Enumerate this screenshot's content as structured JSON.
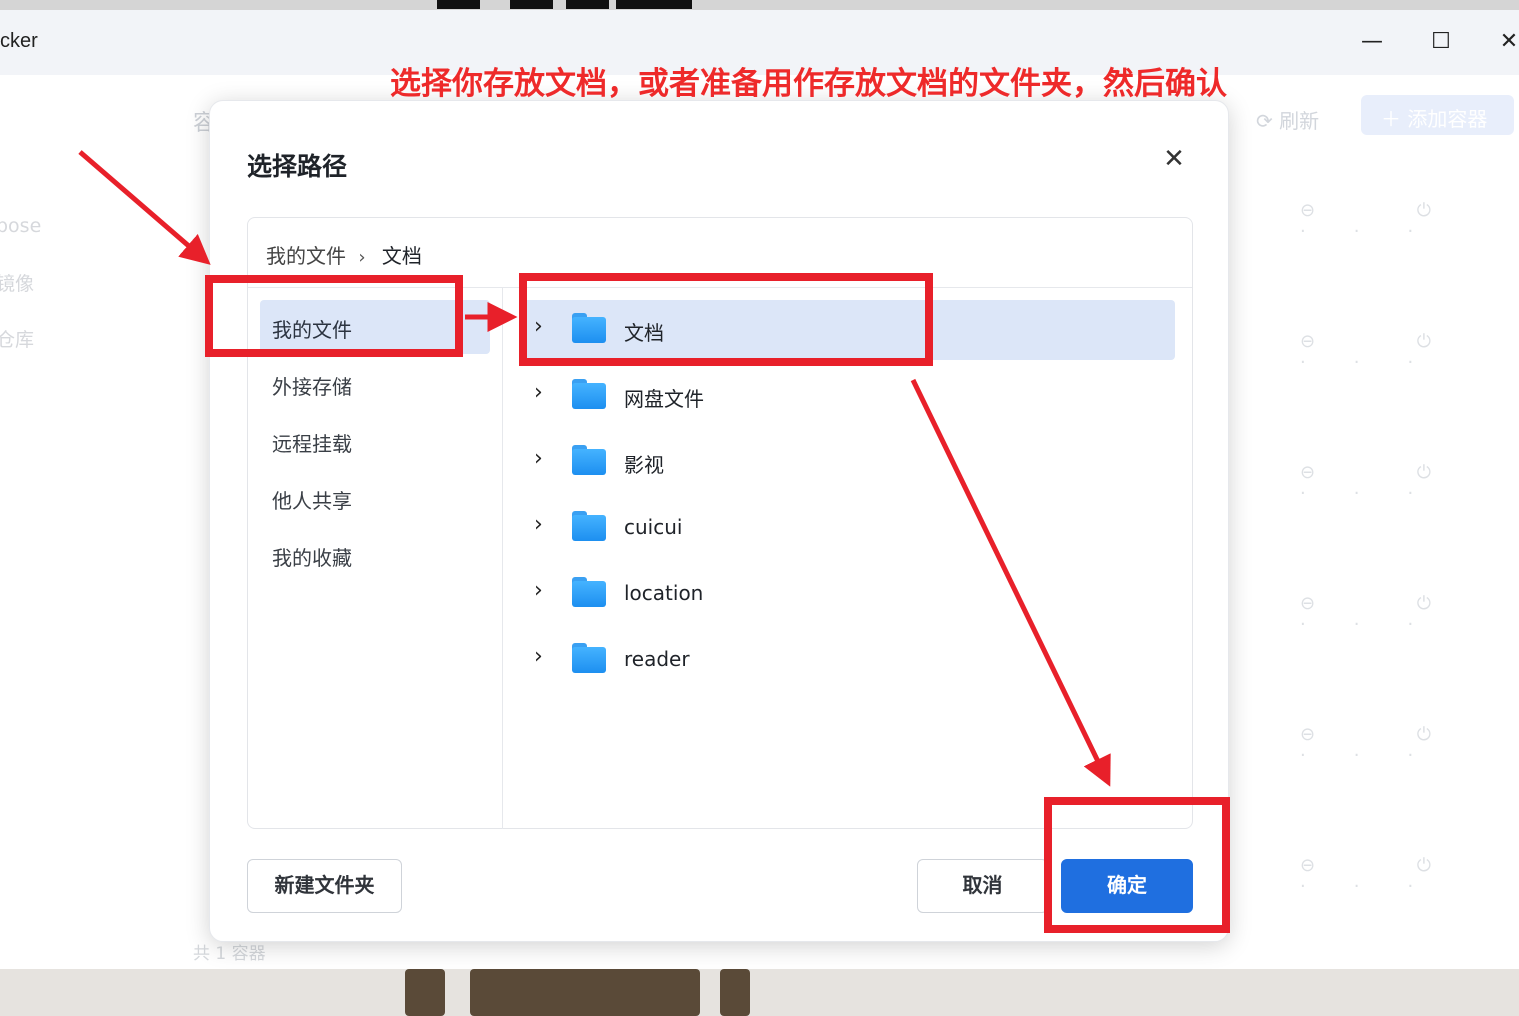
{
  "app": {
    "title": "cker",
    "window_buttons": {
      "minimize": "—",
      "maximize": "☐",
      "close": "✕"
    }
  },
  "background": {
    "tab_label": "容",
    "sidebar": [
      "pose",
      "镜像",
      "仓库"
    ],
    "refresh_label": "刷新",
    "add_label": "添加容器",
    "row_icons": "⊖ ⏻ ···",
    "footer": "共 1 容器"
  },
  "annotation": {
    "instruction": "选择你存放文档，或者准备用作存放文档的文件夹，然后确认",
    "color": "#ee2a2a"
  },
  "dialog": {
    "title": "选择路径",
    "close_icon": "✕",
    "breadcrumb": [
      "我的文件",
      "文档"
    ],
    "breadcrumb_sep": "›",
    "sidebar": [
      {
        "label": "我的文件",
        "active": true
      },
      {
        "label": "外接存储",
        "active": false
      },
      {
        "label": "远程挂载",
        "active": false
      },
      {
        "label": "他人共享",
        "active": false
      },
      {
        "label": "我的收藏",
        "active": false
      }
    ],
    "folders": [
      {
        "name": "文档",
        "selected": true
      },
      {
        "name": "网盘文件",
        "selected": false
      },
      {
        "name": "影视",
        "selected": false
      },
      {
        "name": "cuicui",
        "selected": false
      },
      {
        "name": "location",
        "selected": false
      },
      {
        "name": "reader",
        "selected": false
      }
    ],
    "chevron": "›",
    "buttons": {
      "new_folder": "新建文件夹",
      "cancel": "取消",
      "confirm": "确定"
    },
    "accent_color": "#1f6fe0",
    "selected_bg": "#dce6f8"
  }
}
